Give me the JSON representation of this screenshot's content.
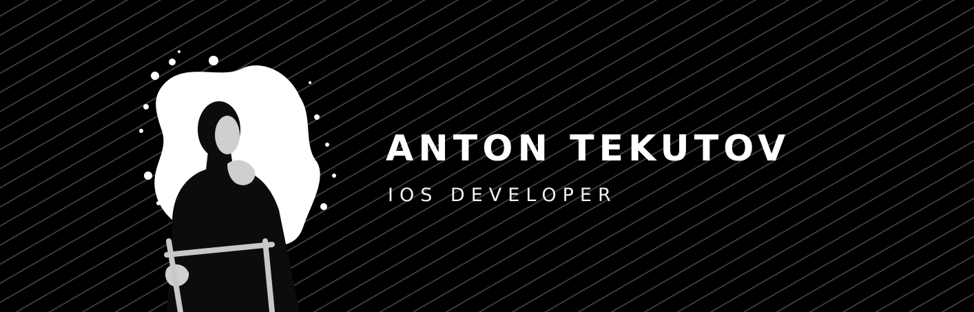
{
  "profile": {
    "name": "ANTON TEKUTOV",
    "role": "IOS DEVELOPER"
  },
  "colors": {
    "background": "#000000",
    "stripes": "#3a3a3a",
    "text": "#ffffff"
  }
}
